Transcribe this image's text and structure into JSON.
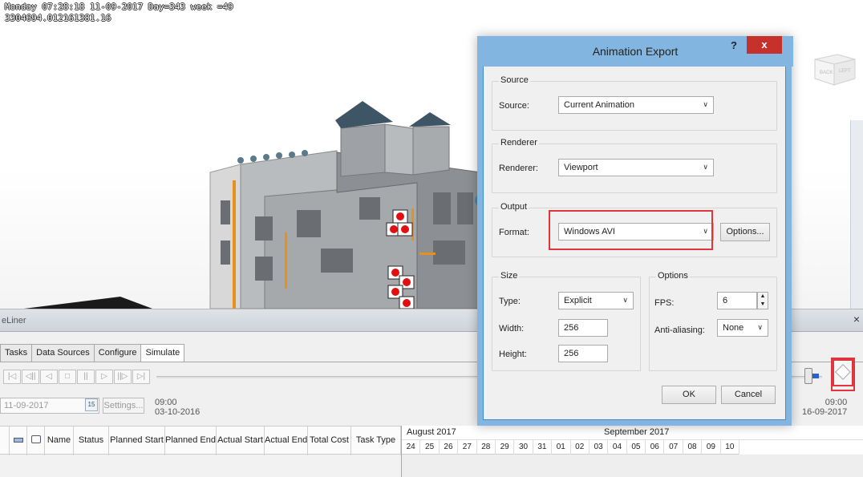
{
  "viewport": {
    "overlay_line_1": "Monday 07:28:18 11-09-2017 Day=343 week =49",
    "overlay_line_2": "3304694.012161381.16",
    "viewcube": {
      "face_back": "BACK",
      "face_left": "LEFT"
    }
  },
  "timeliner": {
    "title": "eLiner",
    "close_label": "×",
    "tabs": [
      {
        "label": "Tasks"
      },
      {
        "label": "Data Sources"
      },
      {
        "label": "Configure"
      },
      {
        "label": "Simulate",
        "active": true
      }
    ],
    "playback_buttons": [
      "|◁",
      "◁||",
      "◁",
      "□",
      "||",
      "▷",
      "||▷",
      "▷|"
    ],
    "date_value": "11-09-2017",
    "calendar_icon_text": "15",
    "settings_label": "Settings...",
    "start_time": "09:00",
    "start_date": "03-10-2016",
    "end_time": "09:00",
    "end_date": "16-09-2017",
    "slider_position": 0.985,
    "columns": [
      {
        "label": ""
      },
      {
        "label": ""
      },
      {
        "label": "Name"
      },
      {
        "label": "Status"
      },
      {
        "label": "Planned Start"
      },
      {
        "label": "Planned End"
      },
      {
        "label": "Actual Start"
      },
      {
        "label": "Actual End"
      },
      {
        "label": "Total Cost"
      },
      {
        "label": "Task Type"
      }
    ],
    "gantt": {
      "months": [
        {
          "label": "August 2017"
        },
        {
          "label": "September 2017"
        }
      ],
      "days": [
        "24",
        "25",
        "26",
        "27",
        "28",
        "29",
        "30",
        "31",
        "01",
        "02",
        "03",
        "04",
        "05",
        "06",
        "07",
        "08",
        "09",
        "10"
      ]
    }
  },
  "dialog": {
    "title": "Animation Export",
    "help_label": "?",
    "close_label": "x",
    "source_group": "Source",
    "source_label": "Source:",
    "source_value": "Current Animation",
    "renderer_group": "Renderer",
    "renderer_label": "Renderer:",
    "renderer_value": "Viewport",
    "output_group": "Output",
    "format_label": "Format:",
    "format_value": "Windows AVI",
    "options_button": "Options...",
    "size_group": "Size",
    "type_label": "Type:",
    "type_value": "Explicit",
    "width_label": "Width:",
    "width_value": "256",
    "height_label": "Height:",
    "height_value": "256",
    "options_group": "Options",
    "fps_label": "FPS:",
    "fps_value": "6",
    "antialias_label": "Anti-aliasing:",
    "antialias_value": "None",
    "ok_button": "OK",
    "cancel_button": "Cancel"
  },
  "colors": {
    "highlight": "#e0353a",
    "dialog_frame": "#82b6e0",
    "close_red": "#c7312b",
    "marker_red": "#e01010"
  }
}
